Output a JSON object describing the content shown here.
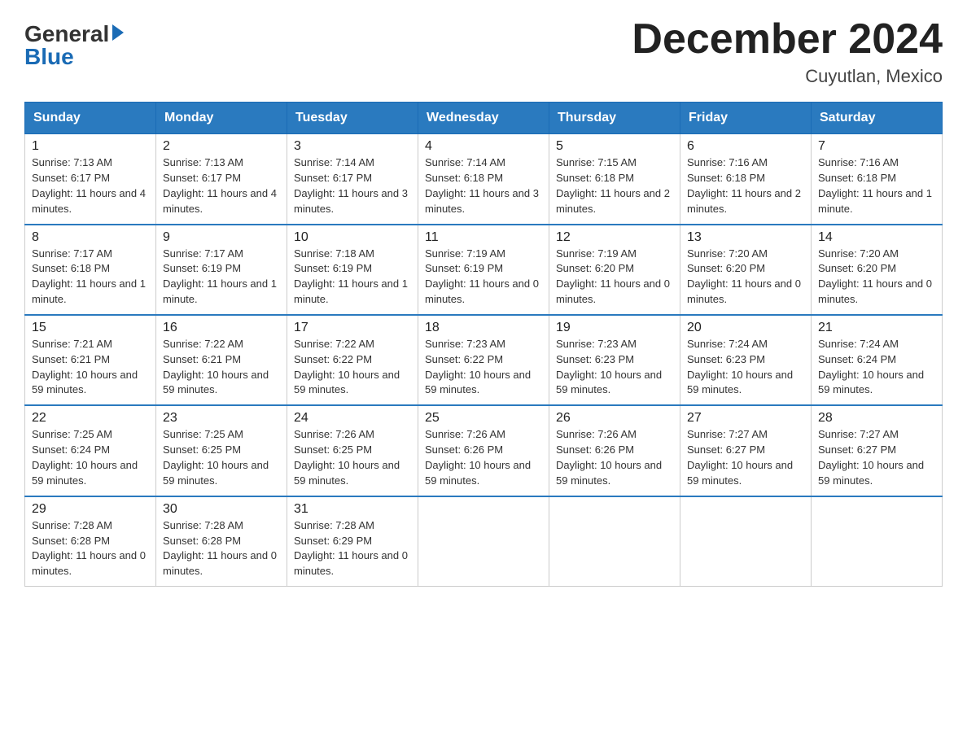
{
  "header": {
    "logo_general": "General",
    "logo_blue": "Blue",
    "month_title": "December 2024",
    "location": "Cuyutlan, Mexico"
  },
  "days_of_week": [
    "Sunday",
    "Monday",
    "Tuesday",
    "Wednesday",
    "Thursday",
    "Friday",
    "Saturday"
  ],
  "weeks": [
    [
      {
        "day": "1",
        "sunrise": "7:13 AM",
        "sunset": "6:17 PM",
        "daylight": "11 hours and 4 minutes."
      },
      {
        "day": "2",
        "sunrise": "7:13 AM",
        "sunset": "6:17 PM",
        "daylight": "11 hours and 4 minutes."
      },
      {
        "day": "3",
        "sunrise": "7:14 AM",
        "sunset": "6:17 PM",
        "daylight": "11 hours and 3 minutes."
      },
      {
        "day": "4",
        "sunrise": "7:14 AM",
        "sunset": "6:18 PM",
        "daylight": "11 hours and 3 minutes."
      },
      {
        "day": "5",
        "sunrise": "7:15 AM",
        "sunset": "6:18 PM",
        "daylight": "11 hours and 2 minutes."
      },
      {
        "day": "6",
        "sunrise": "7:16 AM",
        "sunset": "6:18 PM",
        "daylight": "11 hours and 2 minutes."
      },
      {
        "day": "7",
        "sunrise": "7:16 AM",
        "sunset": "6:18 PM",
        "daylight": "11 hours and 1 minute."
      }
    ],
    [
      {
        "day": "8",
        "sunrise": "7:17 AM",
        "sunset": "6:18 PM",
        "daylight": "11 hours and 1 minute."
      },
      {
        "day": "9",
        "sunrise": "7:17 AM",
        "sunset": "6:19 PM",
        "daylight": "11 hours and 1 minute."
      },
      {
        "day": "10",
        "sunrise": "7:18 AM",
        "sunset": "6:19 PM",
        "daylight": "11 hours and 1 minute."
      },
      {
        "day": "11",
        "sunrise": "7:19 AM",
        "sunset": "6:19 PM",
        "daylight": "11 hours and 0 minutes."
      },
      {
        "day": "12",
        "sunrise": "7:19 AM",
        "sunset": "6:20 PM",
        "daylight": "11 hours and 0 minutes."
      },
      {
        "day": "13",
        "sunrise": "7:20 AM",
        "sunset": "6:20 PM",
        "daylight": "11 hours and 0 minutes."
      },
      {
        "day": "14",
        "sunrise": "7:20 AM",
        "sunset": "6:20 PM",
        "daylight": "11 hours and 0 minutes."
      }
    ],
    [
      {
        "day": "15",
        "sunrise": "7:21 AM",
        "sunset": "6:21 PM",
        "daylight": "10 hours and 59 minutes."
      },
      {
        "day": "16",
        "sunrise": "7:22 AM",
        "sunset": "6:21 PM",
        "daylight": "10 hours and 59 minutes."
      },
      {
        "day": "17",
        "sunrise": "7:22 AM",
        "sunset": "6:22 PM",
        "daylight": "10 hours and 59 minutes."
      },
      {
        "day": "18",
        "sunrise": "7:23 AM",
        "sunset": "6:22 PM",
        "daylight": "10 hours and 59 minutes."
      },
      {
        "day": "19",
        "sunrise": "7:23 AM",
        "sunset": "6:23 PM",
        "daylight": "10 hours and 59 minutes."
      },
      {
        "day": "20",
        "sunrise": "7:24 AM",
        "sunset": "6:23 PM",
        "daylight": "10 hours and 59 minutes."
      },
      {
        "day": "21",
        "sunrise": "7:24 AM",
        "sunset": "6:24 PM",
        "daylight": "10 hours and 59 minutes."
      }
    ],
    [
      {
        "day": "22",
        "sunrise": "7:25 AM",
        "sunset": "6:24 PM",
        "daylight": "10 hours and 59 minutes."
      },
      {
        "day": "23",
        "sunrise": "7:25 AM",
        "sunset": "6:25 PM",
        "daylight": "10 hours and 59 minutes."
      },
      {
        "day": "24",
        "sunrise": "7:26 AM",
        "sunset": "6:25 PM",
        "daylight": "10 hours and 59 minutes."
      },
      {
        "day": "25",
        "sunrise": "7:26 AM",
        "sunset": "6:26 PM",
        "daylight": "10 hours and 59 minutes."
      },
      {
        "day": "26",
        "sunrise": "7:26 AM",
        "sunset": "6:26 PM",
        "daylight": "10 hours and 59 minutes."
      },
      {
        "day": "27",
        "sunrise": "7:27 AM",
        "sunset": "6:27 PM",
        "daylight": "10 hours and 59 minutes."
      },
      {
        "day": "28",
        "sunrise": "7:27 AM",
        "sunset": "6:27 PM",
        "daylight": "10 hours and 59 minutes."
      }
    ],
    [
      {
        "day": "29",
        "sunrise": "7:28 AM",
        "sunset": "6:28 PM",
        "daylight": "11 hours and 0 minutes."
      },
      {
        "day": "30",
        "sunrise": "7:28 AM",
        "sunset": "6:28 PM",
        "daylight": "11 hours and 0 minutes."
      },
      {
        "day": "31",
        "sunrise": "7:28 AM",
        "sunset": "6:29 PM",
        "daylight": "11 hours and 0 minutes."
      },
      null,
      null,
      null,
      null
    ]
  ],
  "labels": {
    "sunrise_prefix": "Sunrise: ",
    "sunset_prefix": "Sunset: ",
    "daylight_prefix": "Daylight: "
  }
}
